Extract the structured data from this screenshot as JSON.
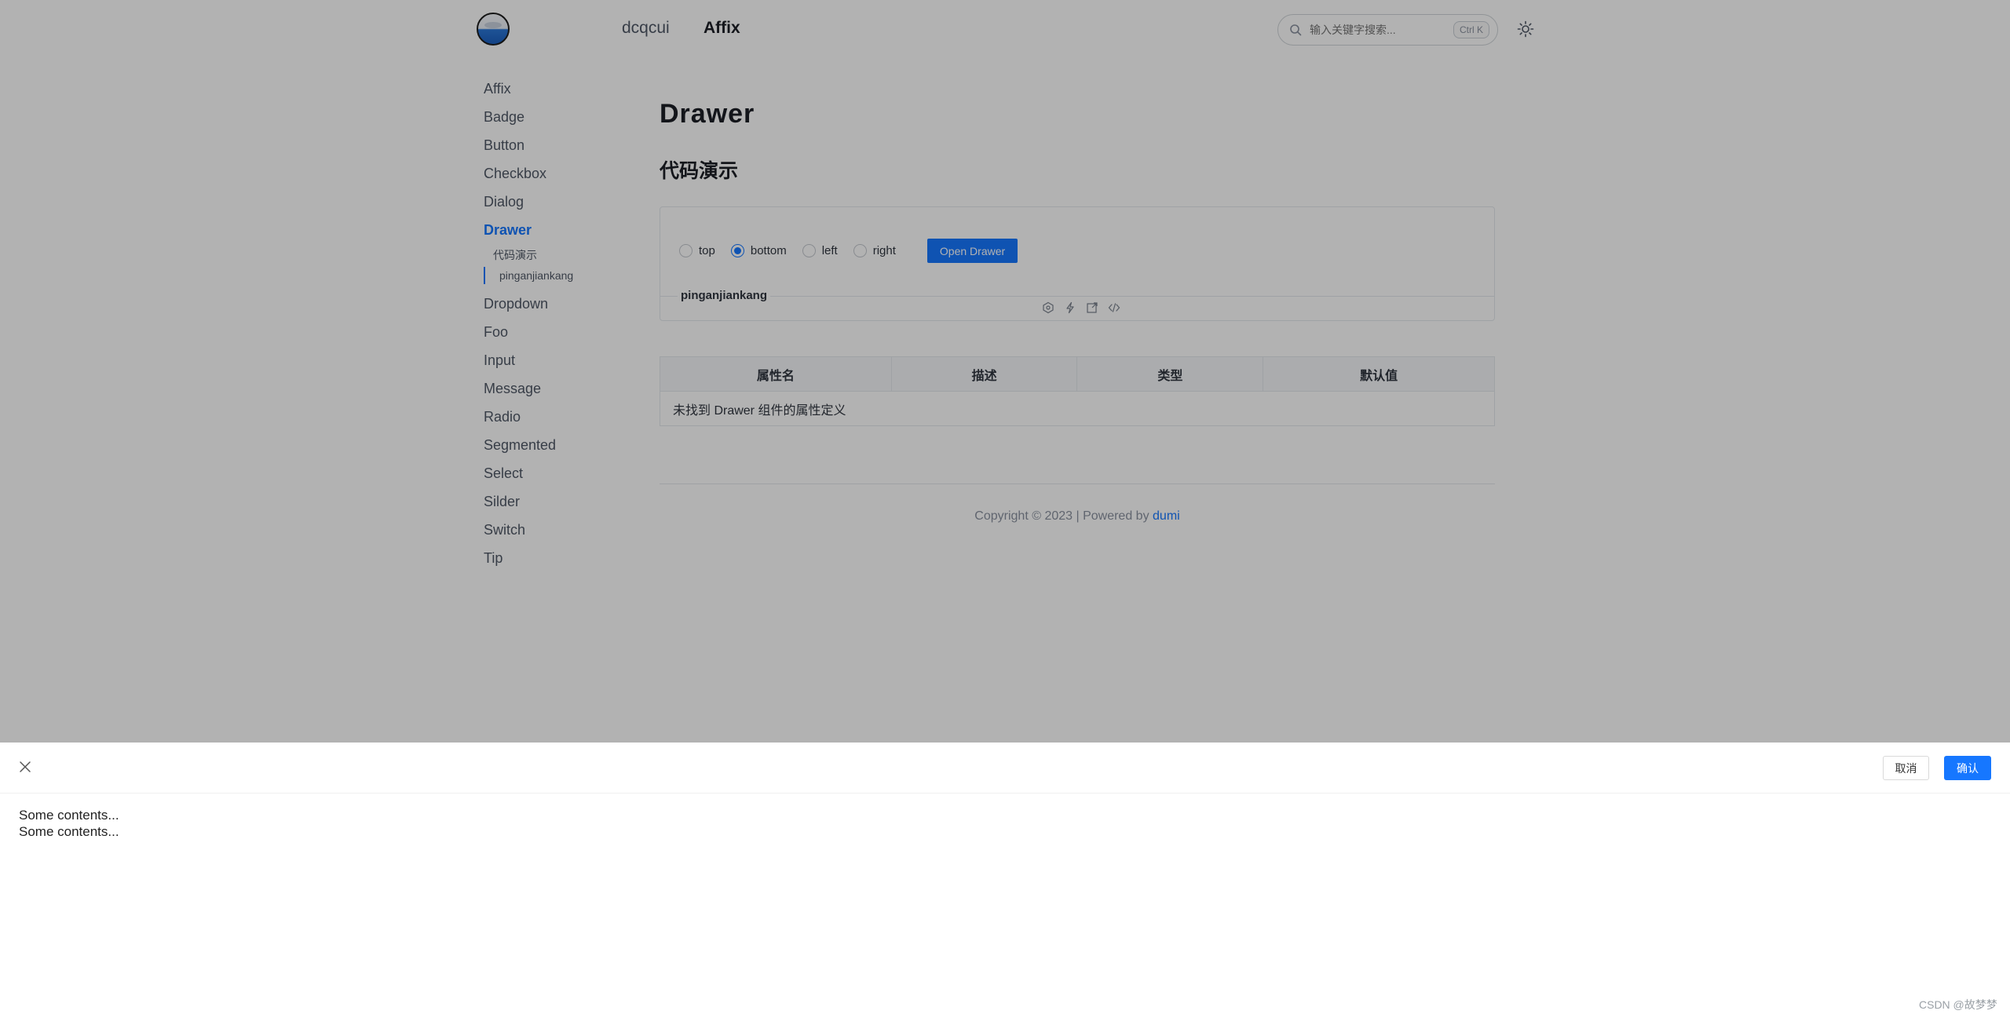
{
  "header": {
    "nav": [
      "dcqcui",
      "Affix"
    ],
    "search_placeholder": "输入关键字搜索...",
    "search_shortcut": "Ctrl K"
  },
  "sidebar": {
    "items_top": [
      "Affix",
      "Badge",
      "Button",
      "Checkbox",
      "Dialog",
      "Drawer"
    ],
    "sub_items": [
      "代码演示",
      "pinganjiankang"
    ],
    "items_bottom": [
      "Dropdown",
      "Foo",
      "Input",
      "Message",
      "Radio",
      "Segmented",
      "Select",
      "Silder",
      "Switch",
      "Tip"
    ]
  },
  "content": {
    "title": "Drawer",
    "section_title": "代码演示",
    "demo": {
      "radios": [
        "top",
        "bottom",
        "left",
        "right"
      ],
      "selected_radio": "bottom",
      "open_button": "Open Drawer",
      "demo_name": "pinganjiankang"
    },
    "api_table": {
      "headers": [
        "属性名",
        "描述",
        "类型",
        "默认值"
      ],
      "empty_message": "未找到 Drawer 组件的属性定义"
    },
    "footer": {
      "text": "Copyright © 2023 | Powered by ",
      "link": "dumi"
    }
  },
  "drawer": {
    "cancel_label": "取消",
    "ok_label": "确认",
    "body_lines": [
      "Some contents...",
      "Some contents..."
    ]
  },
  "watermark": "CSDN @故梦梦",
  "colors": {
    "primary": "#1677ff",
    "mask": "rgba(0,0,0,0.30)"
  }
}
